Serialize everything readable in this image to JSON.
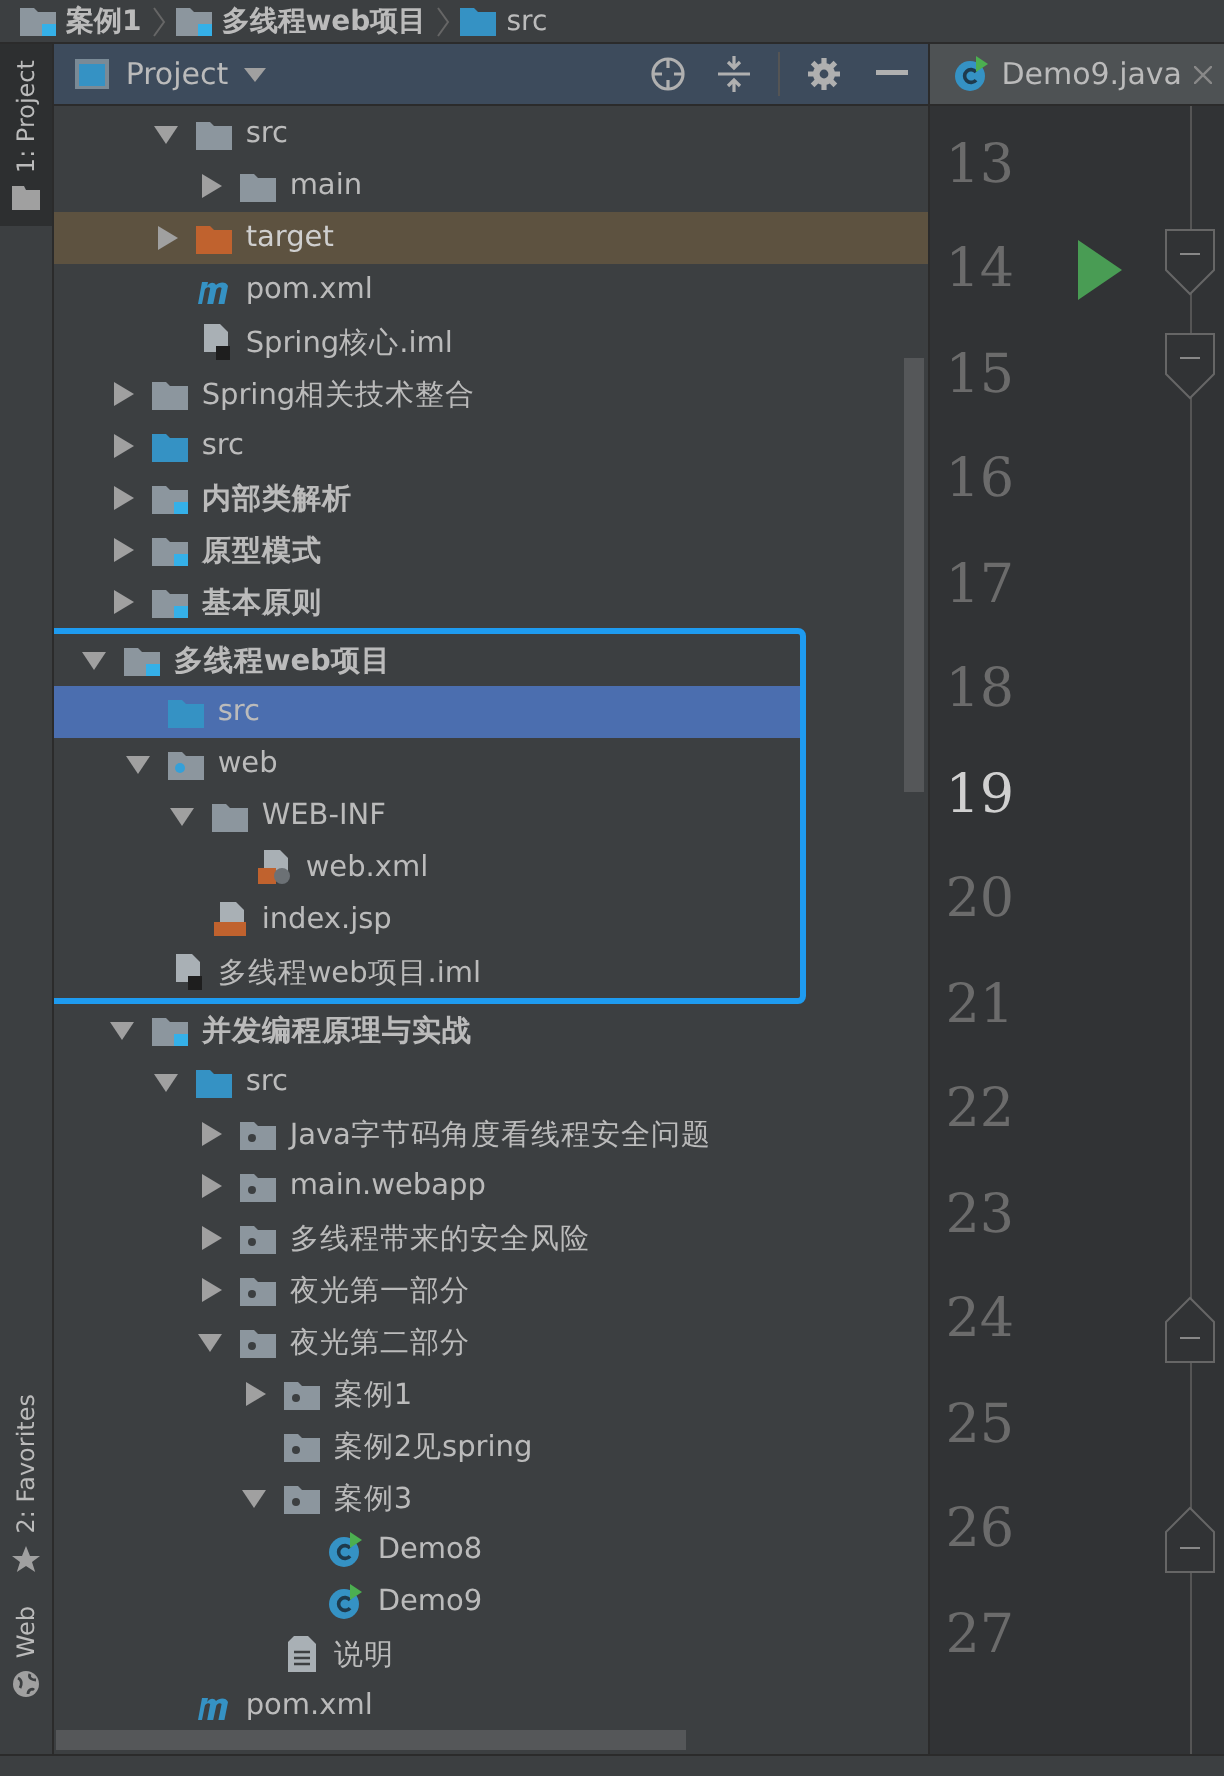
{
  "breadcrumb": [
    {
      "label": "案例1",
      "kind": "module"
    },
    {
      "label": "多线程web项目",
      "kind": "module"
    },
    {
      "label": "src",
      "kind": "source_folder"
    }
  ],
  "left_stripe": [
    {
      "label": "1: Project",
      "selected": true
    },
    {
      "label": "2: Favorites",
      "selected": false
    },
    {
      "label": "Web",
      "selected": false
    }
  ],
  "project_panel": {
    "title": "Project",
    "continued": [
      {
        "label": "src",
        "kind": "folder",
        "expanded": true,
        "selected": false,
        "children": [
          {
            "label": "main",
            "kind": "folder",
            "expanded": false,
            "selected": false
          }
        ]
      },
      {
        "label": "target",
        "kind": "excluded",
        "expanded": false,
        "selected": false
      },
      {
        "label": "pom.xml",
        "kind": "maven",
        "selected": false
      },
      {
        "label": "Spring核心.iml",
        "kind": "iml",
        "selected": false
      }
    ],
    "items": [
      {
        "label": "Spring相关技术整合",
        "kind": "folder",
        "expanded": false,
        "selected": false
      },
      {
        "label": "src",
        "kind": "source_folder",
        "expanded": false,
        "selected": false
      },
      {
        "label": "内部类解析",
        "kind": "module",
        "expanded": false,
        "selected": false
      },
      {
        "label": "原型模式",
        "kind": "module",
        "expanded": false,
        "selected": false
      },
      {
        "label": "基本原则",
        "kind": "module",
        "expanded": false,
        "selected": false
      },
      {
        "label": "多线程web项目",
        "kind": "module",
        "expanded": true,
        "selected": false,
        "highlighted": true,
        "children": [
          {
            "label": "src",
            "kind": "source_folder",
            "selected": true
          },
          {
            "label": "web",
            "kind": "web_folder",
            "expanded": true,
            "selected": false,
            "children": [
              {
                "label": "WEB-INF",
                "kind": "folder",
                "expanded": true,
                "selected": false,
                "children": [
                  {
                    "label": "web.xml",
                    "kind": "xml",
                    "selected": false
                  }
                ]
              },
              {
                "label": "index.jsp",
                "kind": "jsp",
                "selected": false
              }
            ]
          },
          {
            "label": "多线程web项目.iml",
            "kind": "iml",
            "selected": false
          }
        ]
      },
      {
        "label": "并发编程原理与实战",
        "kind": "module",
        "expanded": true,
        "selected": false,
        "children": [
          {
            "label": "src",
            "kind": "source_folder",
            "expanded": true,
            "selected": false,
            "children": [
              {
                "label": "Java字节码角度看线程安全问题",
                "kind": "package",
                "expanded": false,
                "selected": false
              },
              {
                "label": "main.webapp",
                "kind": "package",
                "expanded": false,
                "selected": false
              },
              {
                "label": "多线程带来的安全风险",
                "kind": "package",
                "expanded": false,
                "selected": false
              },
              {
                "label": "夜光第一部分",
                "kind": "package",
                "expanded": false,
                "selected": false
              },
              {
                "label": "夜光第二部分",
                "kind": "package",
                "expanded": true,
                "selected": false,
                "children": [
                  {
                    "label": "案例1",
                    "kind": "package",
                    "expanded": false,
                    "selected": false
                  },
                  {
                    "label": "案例2见spring",
                    "kind": "package",
                    "selected": false
                  },
                  {
                    "label": "案例3",
                    "kind": "package",
                    "expanded": true,
                    "selected": false,
                    "children": [
                      {
                        "label": "Demo8",
                        "kind": "class",
                        "selected": false
                      },
                      {
                        "label": "Demo9",
                        "kind": "class",
                        "selected": false
                      }
                    ]
                  },
                  {
                    "label": "说明",
                    "kind": "text",
                    "selected": false
                  }
                ]
              }
            ]
          },
          {
            "label": "pom.xml",
            "kind": "maven",
            "selected": false
          }
        ]
      }
    ]
  },
  "editor": {
    "tab": {
      "title": "Demo9.java"
    },
    "lines": [
      {
        "number": "13",
        "current": false
      },
      {
        "number": "14",
        "current": false,
        "run": true,
        "fold_open": true
      },
      {
        "number": "15",
        "current": false,
        "fold_open": true
      },
      {
        "number": "16",
        "current": false
      },
      {
        "number": "17",
        "current": false
      },
      {
        "number": "18",
        "current": false
      },
      {
        "number": "19",
        "current": true
      },
      {
        "number": "20",
        "current": false
      },
      {
        "number": "21",
        "current": false
      },
      {
        "number": "22",
        "current": false
      },
      {
        "number": "23",
        "current": false
      },
      {
        "number": "24",
        "current": false,
        "fold_close": true
      },
      {
        "number": "25",
        "current": false
      },
      {
        "number": "26",
        "current": false,
        "fold_close": true
      },
      {
        "number": "27",
        "current": false
      }
    ]
  }
}
